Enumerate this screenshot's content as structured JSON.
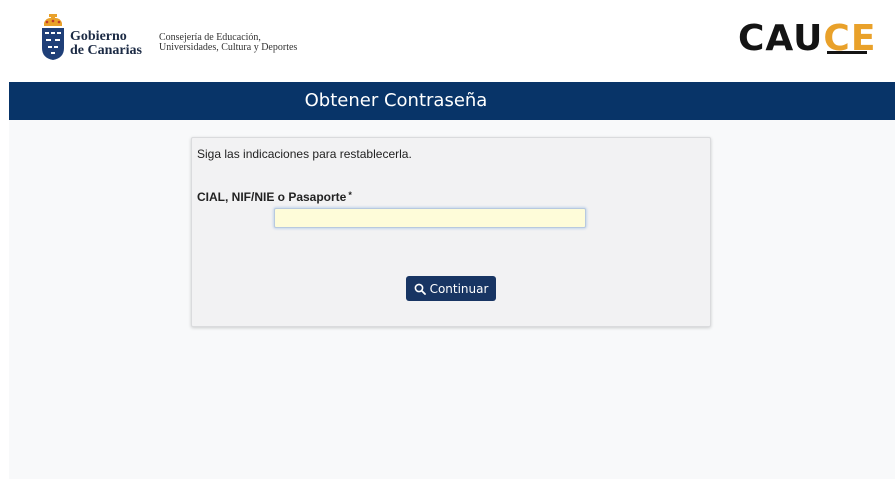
{
  "header": {
    "gobierno_line1": "Gobierno",
    "gobierno_line2": "de Canarias",
    "consejeria_line1": "Consejería de Educación,",
    "consejeria_line2": "Universidades, Cultura y Deportes",
    "cauce_main": "CAU",
    "cauce_accent": "CE"
  },
  "title": "Obtener Contraseña",
  "form": {
    "instructions": "Siga las indicaciones para restablecerla.",
    "field_label": "CIAL, NIF/NIE o Pasaporte",
    "required_mark": "*",
    "field_value": "",
    "button_label": "Continuar",
    "button_icon": "search-icon"
  },
  "colors": {
    "title_bar": "#083468",
    "button": "#183563",
    "cauce_accent": "#e9a12a",
    "input_background": "#fefcd9"
  }
}
